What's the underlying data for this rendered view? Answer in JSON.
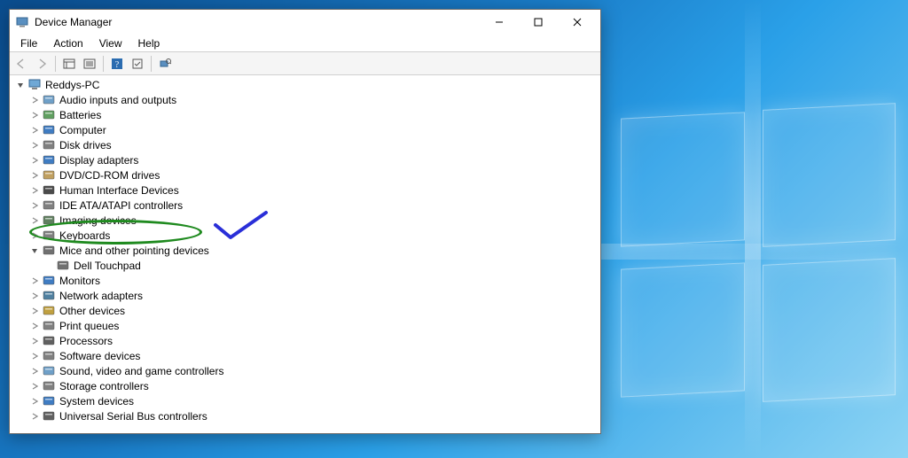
{
  "window": {
    "title": "Device Manager",
    "menus": [
      "File",
      "Action",
      "View",
      "Help"
    ]
  },
  "toolbar": {
    "back": "Back",
    "forward": "Forward",
    "list": "List",
    "details": "Details",
    "help": "Help",
    "refresh": "Refresh",
    "scan": "Scan for hardware changes"
  },
  "tree": {
    "root": "Reddys-PC",
    "items": [
      {
        "label": "Audio inputs and outputs",
        "iconColor": "#6fa0c8"
      },
      {
        "label": "Batteries",
        "iconColor": "#60a060"
      },
      {
        "label": "Computer",
        "iconColor": "#3f7cc2"
      },
      {
        "label": "Disk drives",
        "iconColor": "#808080"
      },
      {
        "label": "Display adapters",
        "iconColor": "#3f7cc2"
      },
      {
        "label": "DVD/CD-ROM drives",
        "iconColor": "#c0a060"
      },
      {
        "label": "Human Interface Devices",
        "iconColor": "#4a4a4a"
      },
      {
        "label": "IDE ATA/ATAPI controllers",
        "iconColor": "#808080"
      },
      {
        "label": "Imaging devices",
        "iconColor": "#608060"
      },
      {
        "label": "Keyboards",
        "iconColor": "#808080"
      },
      {
        "label": "Mice and other pointing devices",
        "iconColor": "#707070",
        "expanded": true,
        "children": [
          {
            "label": "Dell Touchpad",
            "iconColor": "#707070"
          }
        ]
      },
      {
        "label": "Monitors",
        "iconColor": "#3f7cc2"
      },
      {
        "label": "Network adapters",
        "iconColor": "#5080a0"
      },
      {
        "label": "Other devices",
        "iconColor": "#c0a040"
      },
      {
        "label": "Print queues",
        "iconColor": "#808080"
      },
      {
        "label": "Processors",
        "iconColor": "#606060"
      },
      {
        "label": "Software devices",
        "iconColor": "#808080"
      },
      {
        "label": "Sound, video and game controllers",
        "iconColor": "#6fa0c8"
      },
      {
        "label": "Storage controllers",
        "iconColor": "#808080"
      },
      {
        "label": "System devices",
        "iconColor": "#3f7cc2"
      },
      {
        "label": "Universal Serial Bus controllers",
        "iconColor": "#606060"
      }
    ]
  },
  "icons": {
    "computer": "computer",
    "chevronRight": ">",
    "chevronDown": "v"
  },
  "annotations": {
    "circled": "Mice and other pointing devices",
    "checkColor": "#2a2fd8",
    "circleColor": "#1f8a1f"
  }
}
